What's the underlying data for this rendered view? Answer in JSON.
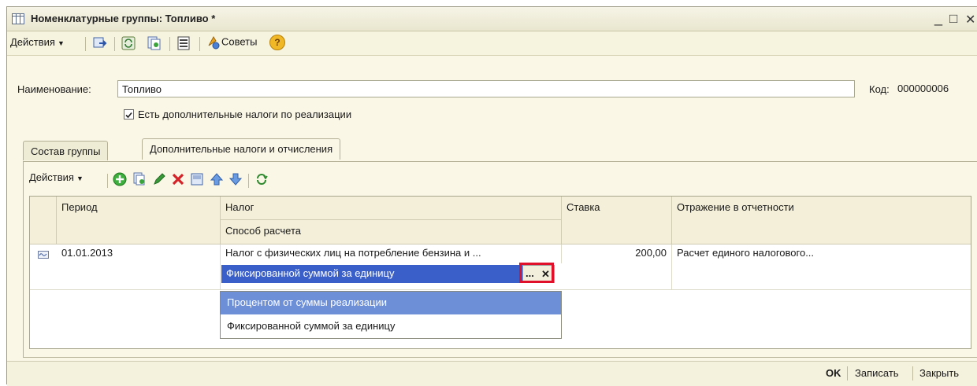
{
  "window": {
    "title": "Номенклатурные группы: Топливо *",
    "minimize": "_",
    "maximize": "□",
    "close": "✕"
  },
  "toolbar": {
    "actions_label": "Действия",
    "tips_label": "Советы",
    "help_label": "?"
  },
  "form": {
    "name_label": "Наименование:",
    "name_value": "Топливо",
    "code_label": "Код:",
    "code_value": "000000006",
    "checkbox_label": "Есть дополнительные налоги по реализации",
    "checkbox_checked": true
  },
  "tabs": [
    {
      "label": "Состав группы",
      "active": false
    },
    {
      "label": "Дополнительные налоги и отчисления",
      "active": true
    }
  ],
  "inner_toolbar": {
    "actions_label": "Действия"
  },
  "table": {
    "headers": {
      "period": "Период",
      "tax": "Налог",
      "method": "Способ расчета",
      "rate": "Ставка",
      "report": "Отражение в отчетности"
    },
    "row": {
      "period": "01.01.2013",
      "tax": "Налог с физических лиц на потребление бензина и ...",
      "method": "Фиксированной суммой за единицу",
      "rate": "200,00",
      "report": "Расчет единого налогового..."
    },
    "select_button": "...",
    "clear_button": "✕"
  },
  "dropdown": {
    "options": [
      "Процентом от суммы реализации",
      "Фиксированной суммой за единицу"
    ],
    "highlighted_index": 0
  },
  "footer": {
    "ok": "OK",
    "save": "Записать",
    "close": "Закрыть"
  },
  "colors": {
    "accent": "#3b5fc8",
    "highlight": "#6d8fd8",
    "annotation": "#e0102a"
  }
}
